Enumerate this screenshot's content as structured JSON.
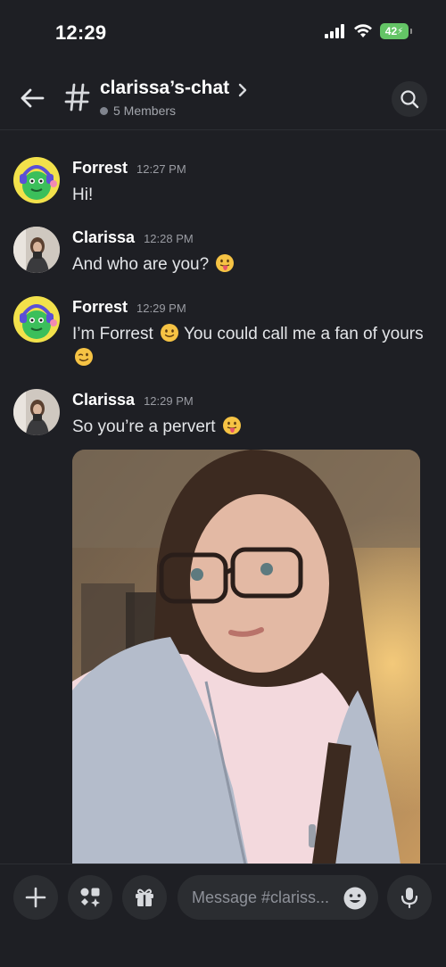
{
  "status_bar": {
    "time": "12:29",
    "battery": "42"
  },
  "header": {
    "channel_name": "clarissa’s-chat",
    "members": "5 Members"
  },
  "messages": [
    {
      "author": "Forrest",
      "time": "12:27 PM",
      "text": "Hi!",
      "avatar": "green-monster-avatar"
    },
    {
      "author": "Clarissa",
      "time": "12:28 PM",
      "text": "And who are you?",
      "emoji": "tongue-emoji",
      "avatar": "photo-avatar"
    },
    {
      "author": "Forrest",
      "time": "12:29 PM",
      "text": "I’m Forrest",
      "emoji_mid": "smile-emoji",
      "text_cont": "You could call me a fan of yours",
      "emoji_end": "wink-emoji",
      "avatar": "green-monster-avatar"
    },
    {
      "author": "Clarissa",
      "time": "12:29 PM",
      "text": "So you’re a pervert",
      "emoji": "tongue-emoji",
      "avatar": "photo-avatar"
    }
  ],
  "composer": {
    "placeholder": "Message #clariss..."
  },
  "colors": {
    "background": "#1e1f24",
    "surface": "#2b2d31",
    "battery": "#64c466",
    "emoji": "#f6c344",
    "avatar_bg": "#f2e14b",
    "avatar_green": "#3bbf5b"
  }
}
